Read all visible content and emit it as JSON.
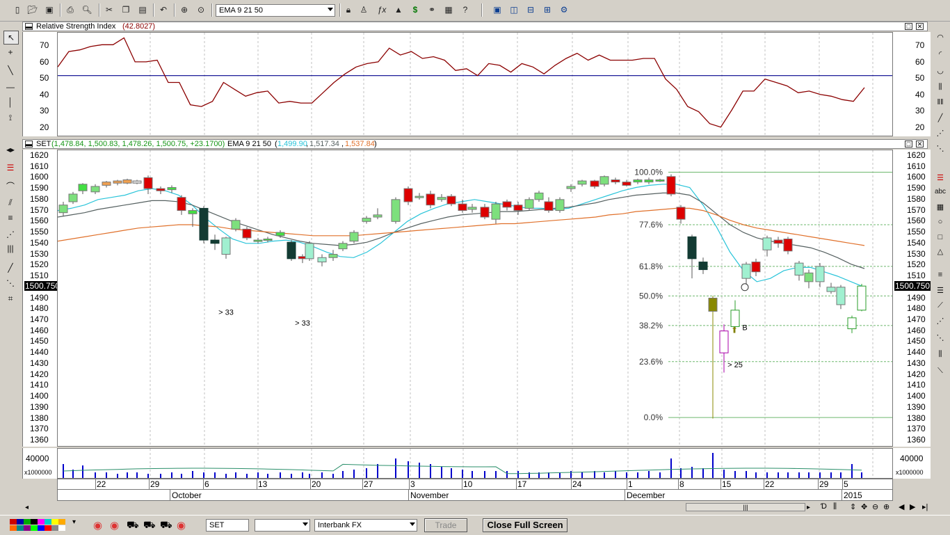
{
  "toolbar": {
    "indicator_combo": "EMA 9 21 50",
    "icons": [
      "new-file-icon",
      "open-folder-icon",
      "save-icon",
      "print-icon",
      "print-preview-icon",
      "cut-icon",
      "copy-icon",
      "paste-icon",
      "undo-icon",
      "crosshair-icon",
      "zoom-icon",
      "lock-icon",
      "person-icon",
      "formula-icon",
      "triangle-icon",
      "dollar-icon",
      "binoculars-icon",
      "news-icon",
      "help-icon",
      "window-cascade-icon",
      "tile-vertical-icon",
      "tile-horizontal-icon",
      "tile-grid-icon",
      "settings-icon"
    ]
  },
  "rsi_panel": {
    "title": "Relative Strength Index",
    "value": "(42.8027)",
    "y_labels": [
      "70",
      "60",
      "50",
      "40",
      "30",
      "20"
    ]
  },
  "price_panel": {
    "title": "SET",
    "ohlc": "(1,478.84, 1,500.83, 1,478.26, 1,500.75, +23.1700)",
    "ema_label": "EMA 9 21 50",
    "ema_open": "(",
    "ema1": "1,499.90",
    "ema_sep": ",",
    "ema2": "1,517.34",
    "ema3": "1,537.84",
    "ema_close": ")",
    "y_labels": [
      "1620",
      "1610",
      "1600",
      "1590",
      "1580",
      "1570",
      "1560",
      "1550",
      "1540",
      "1530",
      "1520",
      "1510",
      "1500.750",
      "1490",
      "1480",
      "1470",
      "1460",
      "1450",
      "1440",
      "1430",
      "1420",
      "1410",
      "1400",
      "1390",
      "1380",
      "1370",
      "1360"
    ],
    "current_price": "1500.750",
    "fib_labels": [
      "100.0%",
      "77.6%",
      "61.8%",
      "50.0%",
      "38.2%",
      "23.6%",
      "0.0%"
    ],
    "annotations": [
      "> 33",
      "> 33",
      "B",
      "> 25"
    ]
  },
  "volume_panel": {
    "label": "40000",
    "multiplier": "x1000000"
  },
  "x_axis": {
    "days": [
      "22",
      "29",
      "6",
      "13",
      "20",
      "27",
      "3",
      "10",
      "17",
      "24",
      "1",
      "8",
      "15",
      "22",
      "29",
      "5"
    ],
    "months": [
      "October",
      "November",
      "December",
      "2015"
    ]
  },
  "statusbar": {
    "symbol_input": "SET",
    "period_combo": "",
    "feed_combo": "Interbank FX",
    "trade_button": "Trade",
    "close_full_screen": "Close Full Screen"
  },
  "chart_data": [
    {
      "type": "line",
      "title": "Relative Strength Index",
      "ylim": [
        15,
        75
      ],
      "series": [
        {
          "name": "Relative Strength Index",
          "values": [
            55,
            64,
            65,
            67,
            68,
            68,
            72,
            58,
            58,
            59,
            46,
            46,
            33,
            32,
            35,
            46,
            42,
            38,
            40,
            41,
            34,
            35,
            34,
            34,
            40,
            46,
            51,
            55,
            57,
            58,
            66,
            62,
            64,
            60,
            61,
            59,
            53,
            54,
            50,
            57,
            56,
            52,
            57,
            55,
            51,
            56,
            60,
            63,
            59,
            62,
            59,
            59,
            59,
            60,
            60,
            48,
            42,
            32,
            29,
            22,
            20,
            30,
            41,
            41,
            48,
            46,
            44,
            40,
            41,
            39,
            38,
            36,
            35,
            43
          ]
        }
      ]
    },
    {
      "type": "line",
      "title": "SET",
      "ylim": [
        1355,
        1625
      ],
      "series": [
        {
          "name": "1,499.90",
          "values": [
            1570,
            1572,
            1575,
            1580,
            1582,
            1584,
            1588,
            1590,
            1588,
            1584,
            1575,
            1563,
            1553,
            1544,
            1540,
            1540,
            1542,
            1543,
            1541,
            1537,
            1532,
            1528,
            1527,
            1532,
            1540,
            1550,
            1560,
            1567,
            1572,
            1576,
            1578,
            1580,
            1578,
            1576,
            1574,
            1572,
            1572,
            1571,
            1572,
            1576,
            1580,
            1584,
            1588,
            1591,
            1593,
            1594,
            1594,
            1591,
            1575,
            1555,
            1532,
            1515,
            1505,
            1508,
            1515,
            1518,
            1518,
            1514,
            1510,
            1505,
            1500
          ]
        },
        {
          "name": "1,517.34",
          "values": [
            1564,
            1566,
            1568,
            1571,
            1573,
            1575,
            1577,
            1579,
            1579,
            1578,
            1575,
            1570,
            1565,
            1560,
            1556,
            1552,
            1548,
            1545,
            1542,
            1540,
            1539,
            1538,
            1539,
            1541,
            1545,
            1550,
            1554,
            1558,
            1561,
            1564,
            1566,
            1567,
            1568,
            1569,
            1569,
            1570,
            1571,
            1572,
            1573,
            1575,
            1577,
            1580,
            1582,
            1584,
            1585,
            1586,
            1586,
            1584,
            1577,
            1567,
            1557,
            1550,
            1545,
            1542,
            1540,
            1538,
            1536,
            1532,
            1527,
            1521,
            1517
          ]
        },
        {
          "name": "1,537.84",
          "values": [
            1542,
            1544,
            1546,
            1548,
            1550,
            1552,
            1554,
            1555,
            1556,
            1557,
            1557,
            1556,
            1555,
            1553,
            1552,
            1551,
            1550,
            1549,
            1548,
            1547,
            1547,
            1547,
            1547,
            1548,
            1549,
            1550,
            1551,
            1552,
            1553,
            1554,
            1555,
            1556,
            1557,
            1558,
            1558,
            1559,
            1560,
            1561,
            1562,
            1563,
            1564,
            1566,
            1567,
            1569,
            1570,
            1571,
            1572,
            1572,
            1570,
            1566,
            1561,
            1557,
            1554,
            1552,
            1550,
            1548,
            1546,
            1544,
            1542,
            1540,
            1538
          ]
        }
      ]
    }
  ],
  "colors": {
    "rsi_line": "#8b0000",
    "rsi_mid": "#00008b",
    "ema1": "#29c4d9",
    "ema2": "#556060",
    "ema3": "#e0702a",
    "fib": "#2a8f2a",
    "volume": "#0000cc"
  }
}
